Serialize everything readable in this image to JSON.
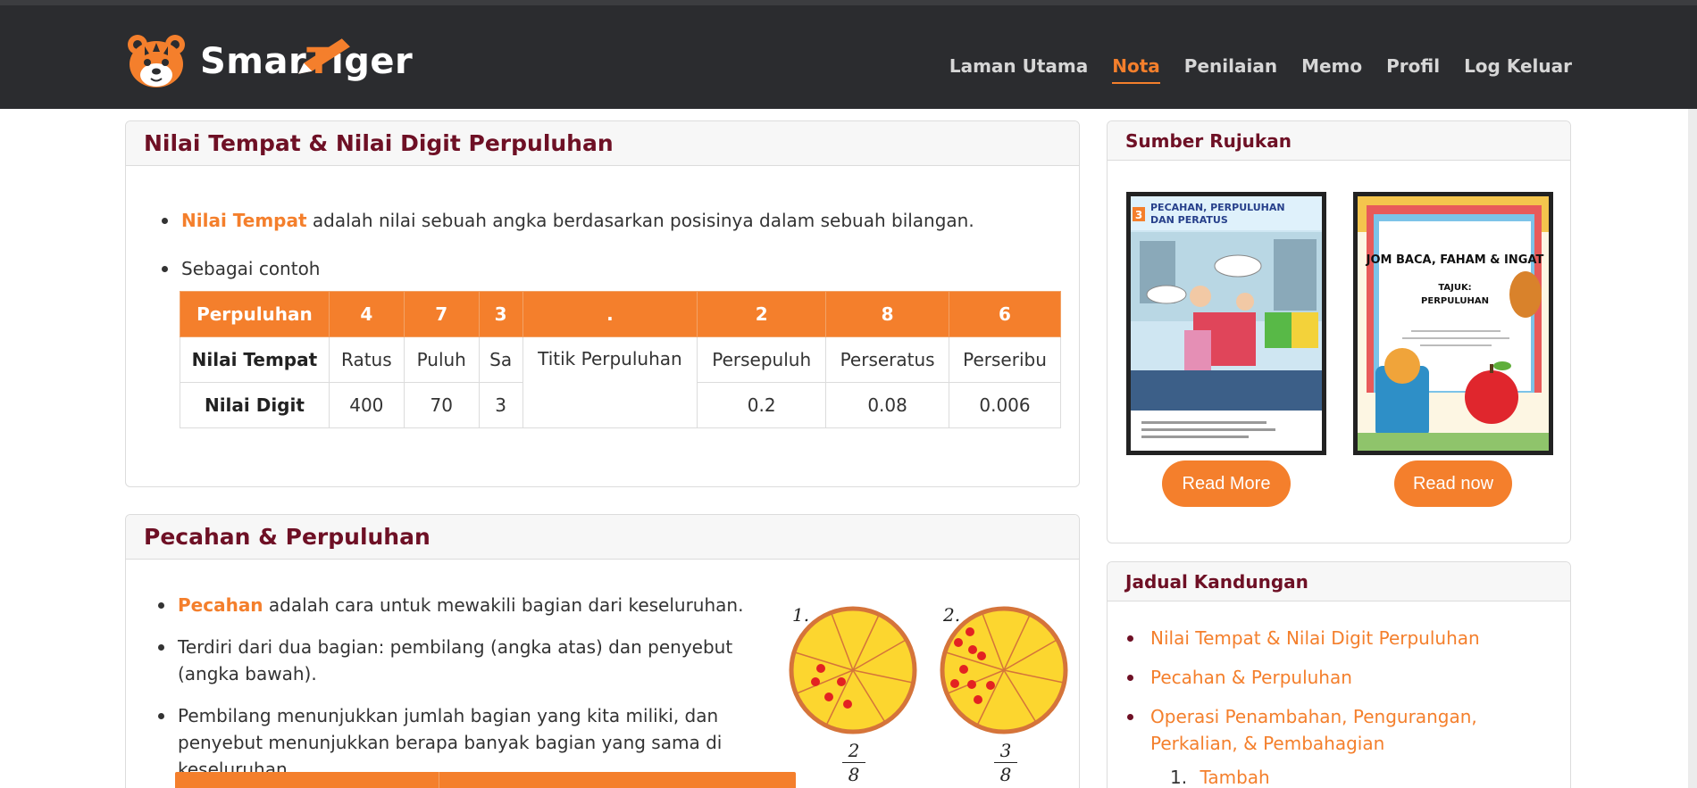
{
  "brand": {
    "name_pre": "Smar",
    "name_t": "T",
    "name_post": "iger"
  },
  "nav": {
    "items": [
      {
        "label": "Laman Utama"
      },
      {
        "label": "Nota"
      },
      {
        "label": "Penilaian"
      },
      {
        "label": "Memo"
      },
      {
        "label": "Profil"
      },
      {
        "label": "Log Keluar"
      }
    ],
    "active": "Nota"
  },
  "section1": {
    "title": "Nilai Tempat & Nilai Digit Perpuluhan",
    "bullet1_term": "Nilai Tempat",
    "bullet1_text": " adalah nilai sebuah angka berdasarkan posisinya dalam sebuah bilangan.",
    "bullet2_text": "Sebagai contoh",
    "table": {
      "headers": [
        "Perpuluhan",
        "4",
        "7",
        "3",
        ".",
        "2",
        "8",
        "6"
      ],
      "row1": [
        "Nilai Tempat",
        "Ratus",
        "Puluh",
        "Sa",
        "Titik Perpuluhan",
        "Persepuluh",
        "Perseratus",
        "Perseribu"
      ],
      "row2": [
        "Nilai Digit",
        "400",
        "70",
        "3",
        "0.2",
        "0.08",
        "0.006"
      ]
    }
  },
  "section2": {
    "title": "Pecahan & Perpuluhan",
    "bullet1_term": "Pecahan",
    "bullet1_text": " adalah cara untuk mewakili bagian dari keseluruhan.",
    "bullet2_text": "Terdiri dari dua bagian: pembilang (angka atas) dan penyebut (angka bawah).",
    "bullet3_text": "Pembilang menunjukkan jumlah bagian yang kita miliki, dan penyebut menunjukkan berapa banyak bagian yang sama di keseluruhan.",
    "pie1": {
      "label": "1.",
      "numerator": "2",
      "denominator": "8"
    },
    "pie2": {
      "label": "2.",
      "numerator": "3",
      "denominator": "8"
    }
  },
  "sidebar": {
    "refs_title": "Sumber Rujukan",
    "book1": {
      "title_line1": "PECAHAN, PERPULUHAN",
      "title_line2": "DAN PERATUS",
      "grade": "3",
      "button": "Read More"
    },
    "book2": {
      "title_line1": "JOM BACA, FAHAM & INGAT",
      "subtitle1": "TAJUK:",
      "subtitle2": "PERPULUHAN",
      "button": "Read now"
    },
    "toc_title": "Jadual Kandungan",
    "toc_items": [
      "Nilai Tempat & Nilai Digit Perpuluhan",
      "Pecahan & Perpuluhan",
      "Operasi Penambahan, Pengurangan, Perkalian, & Pembahagian"
    ],
    "toc_sub": [
      "Tambah"
    ]
  },
  "colors": {
    "accent": "#f47f2c",
    "heading": "#6e1025",
    "navbar": "#2b2c2f",
    "pie_fill": "#fcd62f",
    "pie_rim": "#d5743a",
    "dot": "#e32222"
  }
}
